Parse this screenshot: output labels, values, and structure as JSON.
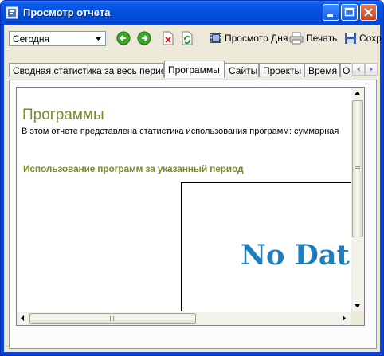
{
  "window": {
    "title": "Просмотр отчета"
  },
  "toolbar": {
    "period_value": "Сегодня",
    "back_icon": "back-arrow-icon",
    "forward_icon": "forward-arrow-icon",
    "delete_icon": "delete-document-icon",
    "refresh_icon": "refresh-document-icon",
    "day_view_label": "Просмотр Дня",
    "print_label": "Печать",
    "save_label": "Сохр"
  },
  "tabs": [
    {
      "label": "Сводная статистика за весь период"
    },
    {
      "label": "Программы",
      "active": true
    },
    {
      "label": "Сайты"
    },
    {
      "label": "Проекты"
    },
    {
      "label": "Время"
    },
    {
      "label": "О"
    }
  ],
  "report": {
    "title": "Программы",
    "description": "В этом отчете представлена статистика использования программ: суммарная",
    "section_title": "Использование программ за указанный период",
    "no_data_text": "No Data"
  },
  "colors": {
    "title_bar": "#0a5ae8",
    "report_heading": "#7a8a2e",
    "no_data": "#1e7fbf",
    "window_body": "#ece9d8"
  }
}
